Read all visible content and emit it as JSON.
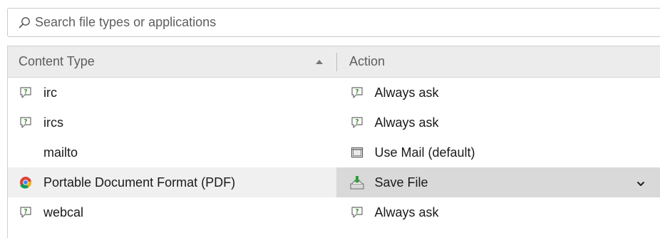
{
  "search": {
    "placeholder": "Search file types or applications"
  },
  "table": {
    "headers": {
      "content_type": "Content Type",
      "action": "Action"
    },
    "sort": "ascending",
    "rows": [
      {
        "type": "irc",
        "type_icon": "chat-bubble-icon",
        "action": "Always ask",
        "action_icon": "chat-bubble-icon"
      },
      {
        "type": "ircs",
        "type_icon": "chat-bubble-icon",
        "action": "Always ask",
        "action_icon": "chat-bubble-icon"
      },
      {
        "type": "mailto",
        "type_icon": "",
        "action": "Use Mail (default)",
        "action_icon": "mail-app-icon"
      },
      {
        "type": "Portable Document Format (PDF)",
        "type_icon": "chrome-icon",
        "action": "Save File",
        "action_icon": "save-file-icon",
        "selected": true
      },
      {
        "type": "webcal",
        "type_icon": "chat-bubble-icon",
        "action": "Always ask",
        "action_icon": "chat-bubble-icon"
      }
    ]
  },
  "colors": {
    "header_bg": "#ececec",
    "selected_action_bg": "#d9d9d9",
    "selected_row_bg": "#f0f0f0",
    "chat_icon_green": "#3b8a2a"
  }
}
